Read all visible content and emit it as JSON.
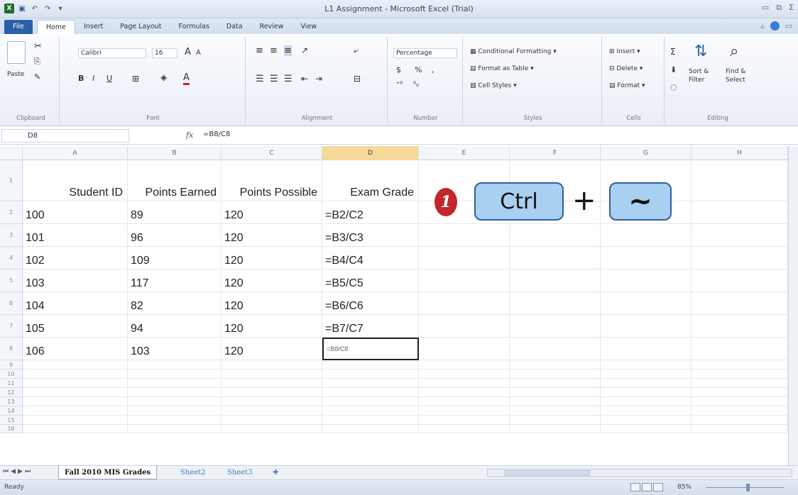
{
  "window": {
    "title": "L1 Assignment - Microsoft Excel (Trial)"
  },
  "ribbon_tabs": [
    "File",
    "Home",
    "Insert",
    "Page Layout",
    "Formulas",
    "Data",
    "Review",
    "View"
  ],
  "ribbon": {
    "clipboard": {
      "paste": "Paste",
      "label": "Clipboard"
    },
    "font": {
      "name": "Calibri",
      "size": "16",
      "label": "Font",
      "bold": "B",
      "italic": "I",
      "underline": "U"
    },
    "alignment": {
      "label": "Alignment"
    },
    "number": {
      "format": "Percentage",
      "currency": "$",
      "percent": "%",
      "comma": ",",
      "label": "Number"
    },
    "styles": {
      "conditional": "Conditional Formatting",
      "table": "Format as Table",
      "cell_styles": "Cell Styles",
      "label": "Styles"
    },
    "cells": {
      "insert": "Insert",
      "delete": "Delete",
      "format": "Format",
      "label": "Cells"
    },
    "editing": {
      "sigma": "Σ",
      "sort_l1": "Sort &",
      "sort_l2": "Filter",
      "find_l1": "Find &",
      "find_l2": "Select",
      "label": "Editing"
    }
  },
  "formula_bar": {
    "name_box": "D8",
    "fx": "fx",
    "formula": "=B8/C8"
  },
  "columns": [
    "A",
    "B",
    "C",
    "D",
    "E",
    "F",
    "G",
    "H"
  ],
  "row_numbers": [
    "1",
    "2",
    "3",
    "4",
    "5",
    "6",
    "7",
    "8",
    "9",
    "10",
    "11",
    "12",
    "13",
    "14",
    "15",
    "16"
  ],
  "headers": [
    "Student ID",
    "Points Earned",
    "Points Possible",
    "Exam Grade"
  ],
  "rows": [
    [
      "100",
      "89",
      "120",
      "=B2/C2"
    ],
    [
      "101",
      "96",
      "120",
      "=B3/C3"
    ],
    [
      "102",
      "109",
      "120",
      "=B4/C4"
    ],
    [
      "103",
      "117",
      "120",
      "=B5/C5"
    ],
    [
      "104",
      "82",
      "120",
      "=B6/C6"
    ],
    [
      "105",
      "94",
      "120",
      "=B7/C7"
    ],
    [
      "106",
      "103",
      "120",
      "=B8/C8"
    ]
  ],
  "overlay": {
    "step": "1",
    "key1": "Ctrl",
    "plus": "+",
    "key2": "~"
  },
  "sheets": [
    "Fall 2010 MIS Grades",
    "Sheet2",
    "Sheet3"
  ],
  "status": {
    "ready": "Ready",
    "zoom": "85%"
  },
  "colors": {
    "file_tab": "#2c5faa",
    "selected_header": "#f7d99a",
    "key_fill": "#a9cff1",
    "badge": "#c1272d"
  }
}
